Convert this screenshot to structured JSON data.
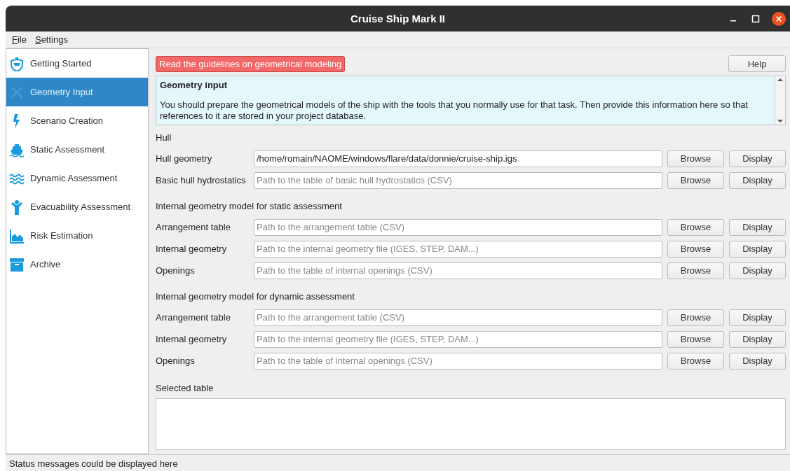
{
  "window": {
    "title": "Cruise Ship Mark II"
  },
  "menu": [
    "File",
    "Settings"
  ],
  "sidebar": {
    "items": [
      {
        "label": "Getting Started",
        "selected": false
      },
      {
        "label": "Geometry Input",
        "selected": true
      },
      {
        "label": "Scenario Creation",
        "selected": false
      },
      {
        "label": "Static Assessment",
        "selected": false
      },
      {
        "label": "Dynamic Assessment",
        "selected": false
      },
      {
        "label": "Evacuability Assessment",
        "selected": false
      },
      {
        "label": "Risk Estimation",
        "selected": false
      },
      {
        "label": "Archive",
        "selected": false
      }
    ]
  },
  "guidelines_link": "Read the guidelines on geometrical modeling",
  "help_button": "Help",
  "info": {
    "title": "Geometry input",
    "body": "You should prepare the geometrical models of the ship with the tools that you normally use for that task. Then provide this information here so that references to it are stored in your project database."
  },
  "sections": [
    {
      "heading": "Hull",
      "rows": [
        {
          "label": "Hull geometry",
          "value": "/home/romain/NAOME/windows/flare/data/donnie/cruise-ship.igs",
          "browse": "Browse",
          "display": "Display"
        },
        {
          "label": "Basic hull hydrostatics",
          "placeholder": "Path to the table of basic hull hydrostatics (CSV)",
          "browse": "Browse",
          "display": "Display"
        }
      ]
    },
    {
      "heading": "Internal geometry model for static assessment",
      "rows": [
        {
          "label": "Arrangement table",
          "placeholder": "Path to the arrangement table (CSV)",
          "browse": "Browse",
          "display": "Display"
        },
        {
          "label": "Internal geometry",
          "placeholder": "Path to the internal geometry file (IGES, STEP, DAM...)",
          "browse": "Browse",
          "display": "Display"
        },
        {
          "label": "Openings",
          "placeholder": "Path to the table of internal openings (CSV)",
          "browse": "Browse",
          "display": "Display"
        }
      ]
    },
    {
      "heading": "Internal geometry model for dynamic assessment",
      "rows": [
        {
          "label": "Arrangement table",
          "placeholder": "Path to the arrangement table (CSV)",
          "browse": "Browse",
          "display": "Display"
        },
        {
          "label": "Internal geometry",
          "placeholder": "Path to the internal geometry file (IGES, STEP, DAM...)",
          "browse": "Browse",
          "display": "Display"
        },
        {
          "label": "Openings",
          "placeholder": "Path to the table of internal openings (CSV)",
          "browse": "Browse",
          "display": "Display"
        }
      ]
    }
  ],
  "selected_table": {
    "heading": "Selected table"
  },
  "status_bar": "Status messages could be displayed here"
}
